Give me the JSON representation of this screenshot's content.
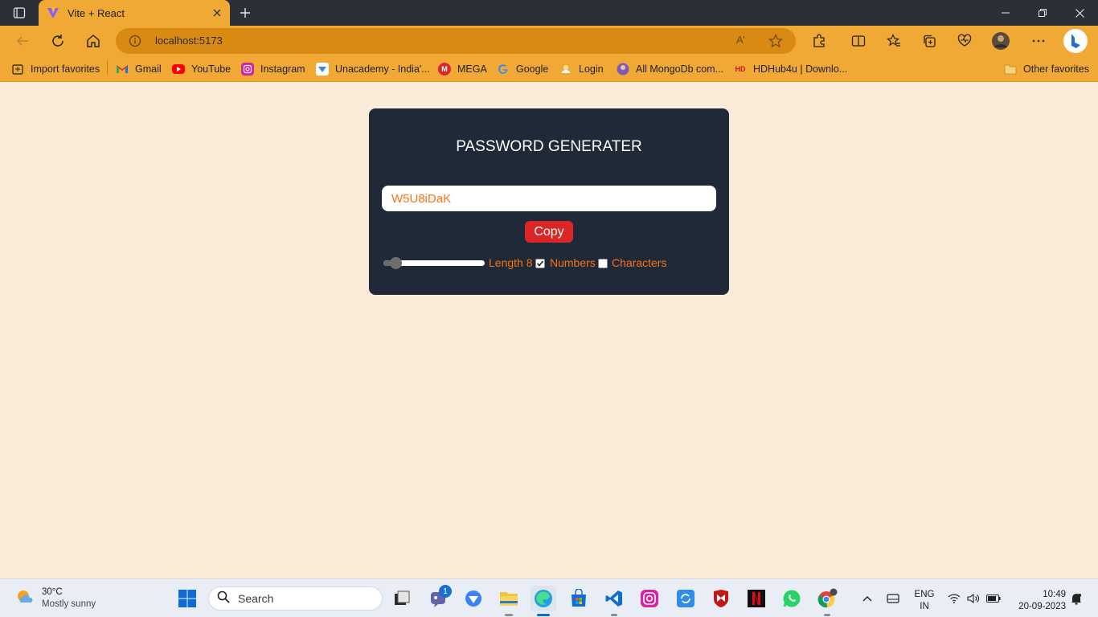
{
  "browser": {
    "tab_title": "Vite + React",
    "url": "localhost:5173",
    "read_aloud_glyph": "A’"
  },
  "bookmarks": [
    {
      "label": "Import favorites",
      "icon": "import-icon"
    },
    {
      "label": "Gmail",
      "icon": "gmail-icon"
    },
    {
      "label": "YouTube",
      "icon": "youtube-icon"
    },
    {
      "label": "Instagram",
      "icon": "instagram-icon"
    },
    {
      "label": "Unacademy - India'...",
      "icon": "unacademy-icon"
    },
    {
      "label": "MEGA",
      "icon": "mega-icon"
    },
    {
      "label": "Google",
      "icon": "google-icon"
    },
    {
      "label": "Login",
      "icon": "login-icon"
    },
    {
      "label": "All MongoDb com...",
      "icon": "mongodb-icon"
    },
    {
      "label": "HDHub4u | Downlo...",
      "icon": "hdhub-icon"
    }
  ],
  "other_favorites": "Other favorites",
  "generator": {
    "title": "PASSWORD GENERATER",
    "password": "W5U8iDaK",
    "copy_label": "Copy",
    "length_label": "Length 8",
    "length_slider_fraction": 0.07,
    "numbers_label": "Numbers",
    "numbers_checked": true,
    "characters_label": "Characters",
    "characters_checked": false
  },
  "taskbar": {
    "temperature": "30°C",
    "weather": "Mostly sunny",
    "search_placeholder": "Search",
    "teams_badge": "1",
    "language": "ENG",
    "region": "IN",
    "time": "10:49",
    "date": "20-09-2023"
  },
  "colors": {
    "browser_accent": "#f0a935",
    "page_background": "#fbebd9",
    "card_background": "#1f2937",
    "password_text": "#f97316",
    "copy_button": "#dc2626"
  }
}
